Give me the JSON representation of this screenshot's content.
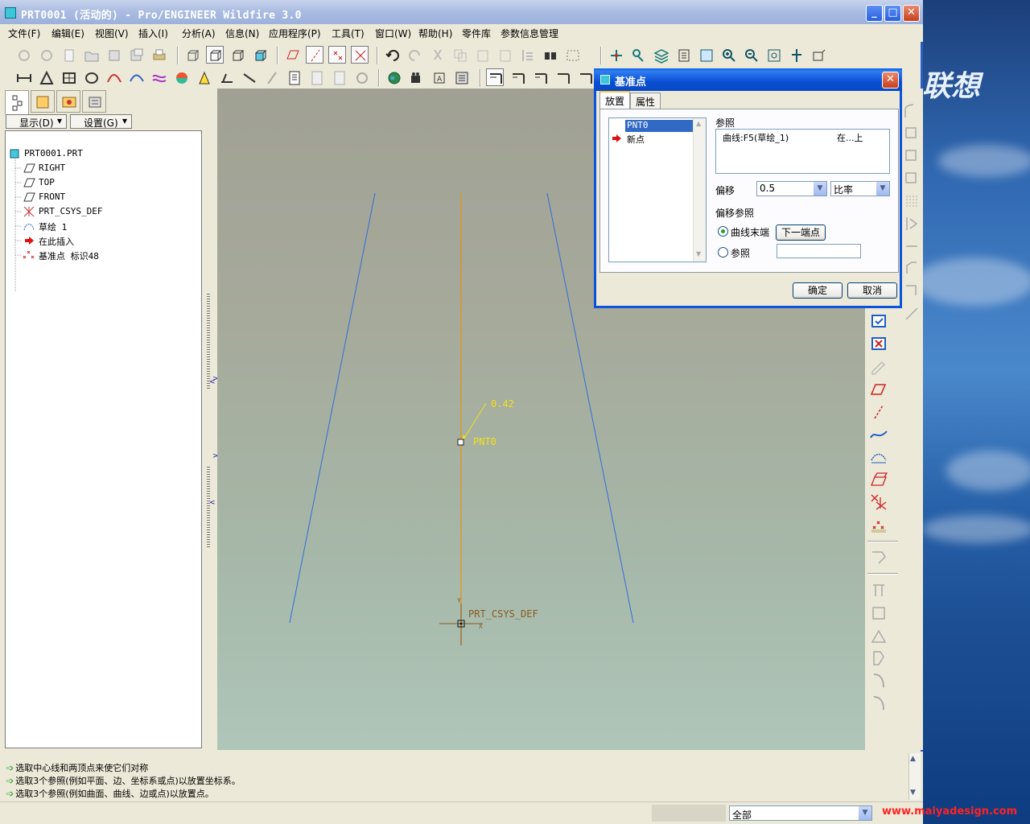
{
  "window": {
    "title": "PRT0001 (活动的) - Pro/ENGINEER Wildfire 3.0"
  },
  "desktop": {
    "brand_fragment": "联想",
    "watermark": "www.maiyadesign.com"
  },
  "menu": {
    "items": [
      "文件(F)",
      "编辑(E)",
      "视图(V)",
      "插入(I)",
      "分析(A)",
      "信息(N)",
      "应用程序(P)",
      "工具(T)",
      "窗口(W)",
      "帮助(H)",
      "零件库",
      "参数信息管理"
    ]
  },
  "left_panel": {
    "display_label": "显示(D)",
    "settings_label": "设置(G)",
    "tree": {
      "root": "PRT0001.PRT",
      "items": [
        "RIGHT",
        "TOP",
        "FRONT",
        "PRT_CSYS_DEF",
        "草绘 1",
        "在此插入",
        "基准点 标识48"
      ]
    }
  },
  "graphics": {
    "ratio_label": "0.42",
    "point_label": "PNT0",
    "csys_label": "PRT_CSYS_DEF",
    "axis_y": "Y",
    "axis_x": "X"
  },
  "messages": [
    "选取中心线和两顶点来使它们对称",
    "选取3个参照(例如平面、边、坐标系或点)以放置坐标系。",
    "选取3个参照(例如曲面、曲线、边或点)以放置点。"
  ],
  "status": {
    "filter_value": "全部"
  },
  "dialog": {
    "title": "基准点",
    "tabs": [
      "放置",
      "属性"
    ],
    "point_list": [
      "PNT0",
      "新点"
    ],
    "references_label": "参照",
    "reference_item": "曲线:F5(草绘_1)",
    "reference_type": "在...上",
    "offset_label": "偏移",
    "offset_value": "0.5",
    "offset_type": "比率",
    "offset_ref_label": "偏移参照",
    "radio_curve_end": "曲线末端",
    "next_end_button": "下一端点",
    "radio_reference": "参照",
    "ok_button": "确定",
    "cancel_button": "取消"
  },
  "colors": {
    "curve_blue": "#2f6fd8",
    "curve_orange": "#e8920e",
    "label_yellow": "#f2e11a",
    "titlebar_blue": "#0a53da"
  }
}
